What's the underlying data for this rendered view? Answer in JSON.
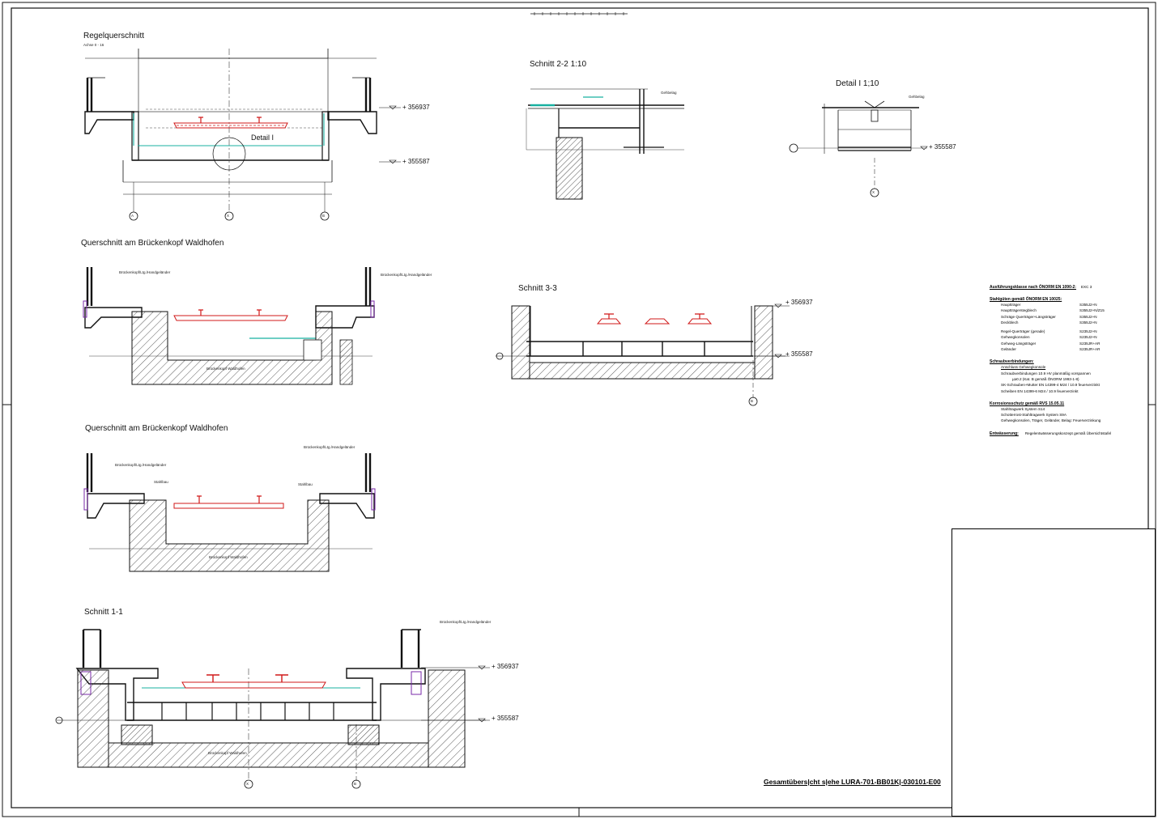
{
  "views": {
    "regel": {
      "title": "Regelquerschnitt",
      "subtitle": "Achse 0 - 16",
      "detail_label": "Detail I",
      "level_top": "+ 356937",
      "level_bottom": "+ 355587",
      "axes": [
        "A",
        "X",
        "B"
      ]
    },
    "bk1": {
      "title": "Querschnitt am Brückenkopf Waldhofen",
      "label_left": "Brückenkopf/Ltg./Handgeländer",
      "label_right": "Brückenkopf/Ltg./Handgeländer",
      "abut_label": "Brückenkopf Waldhofen"
    },
    "bk2": {
      "title": "Querschnitt am Brückenkopf Waldhofen",
      "label_left": "Brückenkopf/Ltg./Handgeländer",
      "label_right": "Brückenkopf/Ltg./Handgeländer",
      "abut_label": "Brückenkopf Waldhofen",
      "label_mid_left": "Stahlbau",
      "label_mid_right": "Stahlbau"
    },
    "s11": {
      "title": "Schnitt 1-1",
      "level_top": "+ 356937",
      "level_bottom": "+ 355587",
      "label_top": "Brückenkopf/Ltg./Handgeländer",
      "abut_label": "Brückenkopf Waldhofen",
      "axes": [
        "X",
        "B"
      ]
    },
    "s22": {
      "title": "Schnitt 2-2 1:10",
      "label": "Gehbelag"
    },
    "detail": {
      "title": "Detail I 1;10",
      "label": "Gehbelag",
      "level": "+ 355587",
      "axis": "X"
    },
    "s33": {
      "title": "Schnitt 3-3",
      "level_top": "+ 356937",
      "level_bottom": "+ 355587",
      "axis": "B"
    }
  },
  "notes": {
    "exc_heading": "Ausführungsklasse nach ÖNORM EN 1090-2:",
    "exc_value": "EXC 3",
    "steel_heading": "Stahlgüten gemäß ÖNORM EN 10025:",
    "steel_rows": [
      {
        "k": "Hauptträger",
        "v": "S355J2+N"
      },
      {
        "k": "Hauptträgerstegblech",
        "v": "S355J2+N/Z15"
      },
      {
        "k": "Schräge Querträger+Längsträger",
        "v": "S355J2+N"
      },
      {
        "k": "Deckblech",
        "v": "S355J2+N"
      },
      {
        "k": "",
        "v": ""
      },
      {
        "k": "Regel-Querträger (gerade)",
        "v": "S235J2+N"
      },
      {
        "k": "Gehwegkonsolen",
        "v": "S235J2+N"
      },
      {
        "k": "Gehweg-Längsträger",
        "v": "S235JR+AR"
      },
      {
        "k": "Geländer",
        "v": "S235JR+AR"
      }
    ],
    "bolt_heading": "Schraubverbindungen:",
    "bolt_lines": [
      "Anschluss Gehwegkonsole",
      "Schraubverbindungen 10.9 HV planmäßig vorspannen",
      "μ≥0.2 (Kat. B gemäß ÖNORM 1993-1-8)",
      "SK-Schrauben+Mutter EN 14399-4 M24 / 10.9 feuerverzinkt",
      "Scheiben EN 14399-6 M24 / 10.9 feuerverzinkt"
    ],
    "corr_heading": "Korrosionsschutz gemäß RVS 15.05.11",
    "corr_lines": [
      "Stahltragwerk System S14",
      "Schotterrost-Stahltragwerk System S9A",
      "Gehwegkonsolen, Träger, Geländer, Belag: Feuerverzinkung"
    ],
    "drain_heading": "Entwässerung:",
    "drain_text": "Regelentwässerungskonzept gemäß Übersichtstafel"
  },
  "overview_ref": "Gesamtübers|cht s|ehe LURA-701-BB01K|-030101-E00",
  "colors": {
    "rail": "#d01818",
    "accent": "#18b0a0",
    "purple": "#7a2aa8",
    "line": "#111111"
  }
}
